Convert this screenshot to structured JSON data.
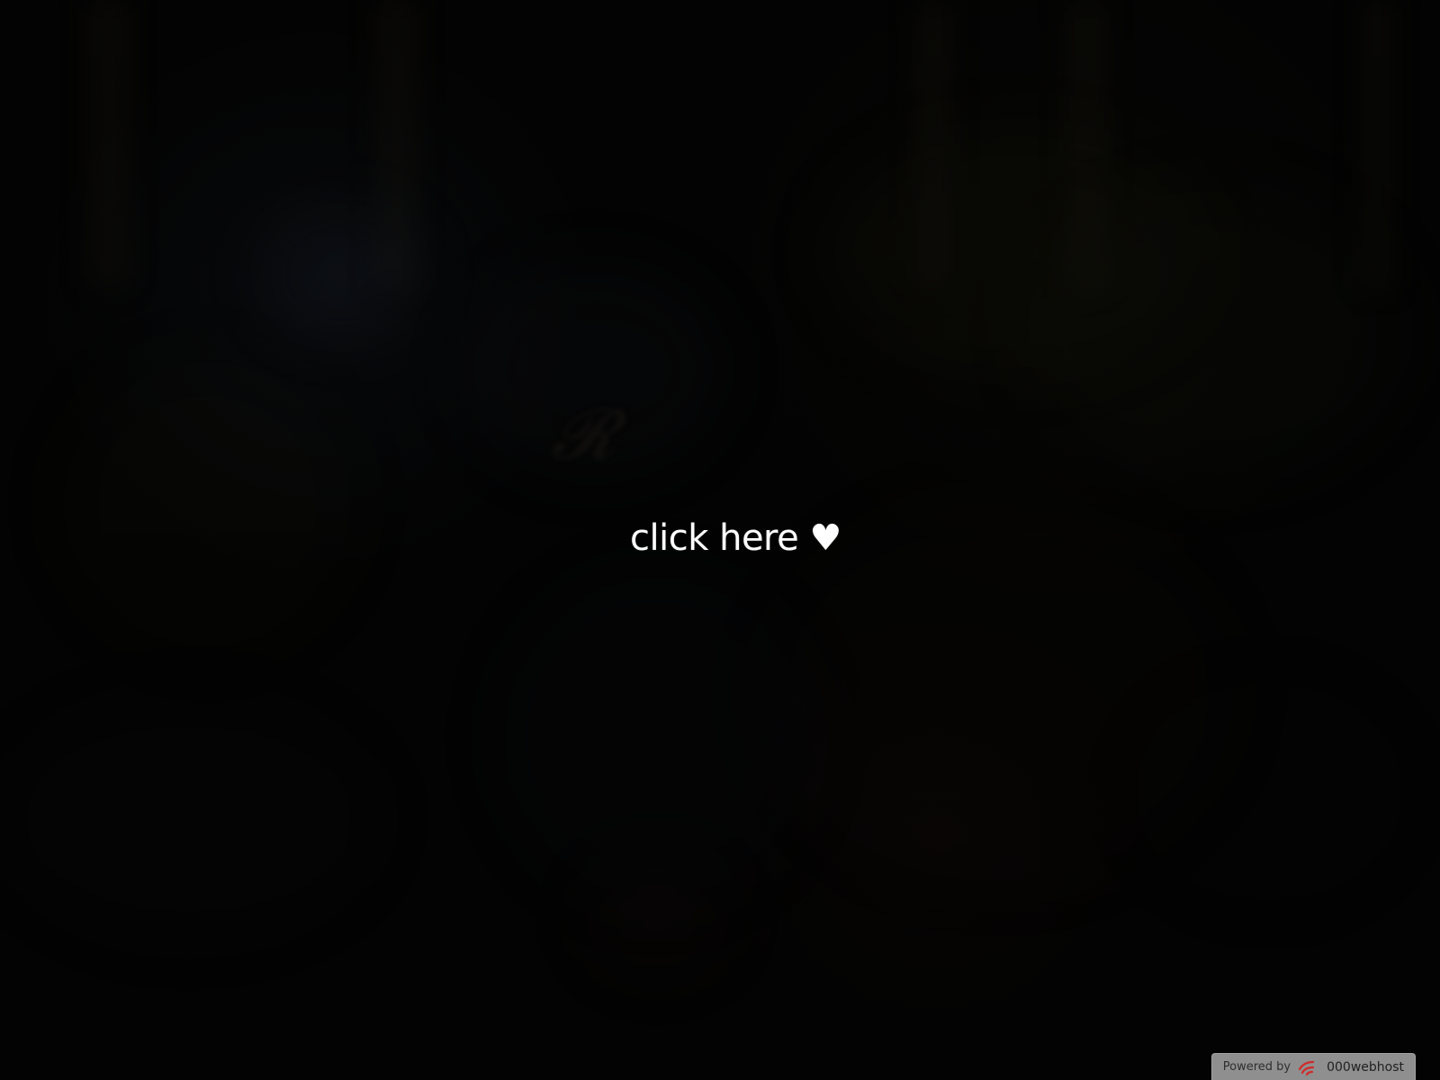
{
  "main": {
    "link_label": "click here ♥"
  },
  "footer": {
    "badge_prefix": "Powered by",
    "brand_name": "000webhost"
  },
  "colors": {
    "background": "#040404",
    "link_text": "#ffffff",
    "badge_bg": "#8f8f8f",
    "brand_accent": "#d02a2a"
  },
  "icons": {
    "brand_icon": "000webhost-logo-icon"
  }
}
